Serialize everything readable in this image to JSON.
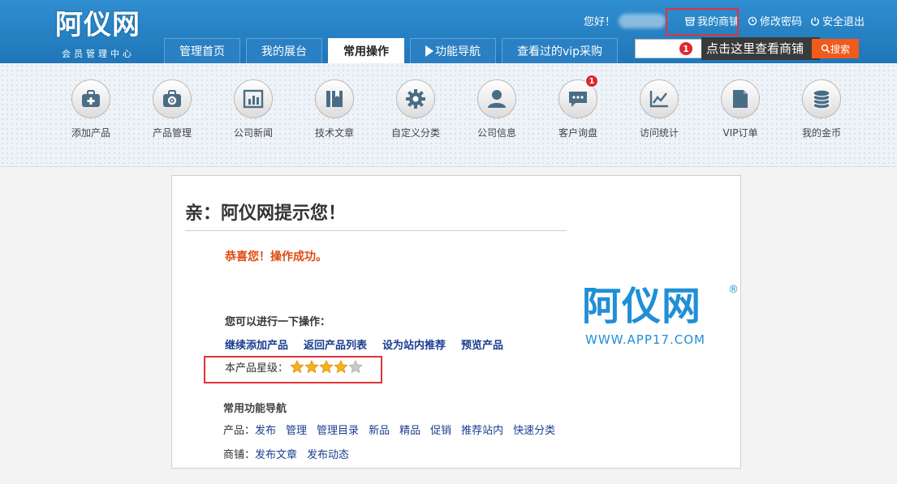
{
  "header": {
    "logo_text": "阿仪网",
    "logo_sub": "会员管理中心",
    "greeting": "您好！",
    "links": {
      "my_shop": "我的商铺",
      "change_password": "修改密码",
      "logout": "安全退出"
    },
    "search_placeholder": "",
    "search_button": "搜索",
    "badge": "1",
    "tooltip": "点击这里查看商铺"
  },
  "nav": {
    "tabs": [
      "管理首页",
      "我的展台",
      "常用操作",
      "功能导航",
      "查看过的vip采购"
    ],
    "active_index": 2
  },
  "toolbar": {
    "items": [
      {
        "label": "添加产品",
        "icon": "add-product-icon"
      },
      {
        "label": "产品管理",
        "icon": "product-manage-icon"
      },
      {
        "label": "公司新闻",
        "icon": "news-icon"
      },
      {
        "label": "技术文章",
        "icon": "article-icon"
      },
      {
        "label": "自定义分类",
        "icon": "gear-icon"
      },
      {
        "label": "公司信息",
        "icon": "user-icon"
      },
      {
        "label": "客户询盘",
        "icon": "chat-icon"
      },
      {
        "label": "访问统计",
        "icon": "stats-icon"
      },
      {
        "label": "VIP订单",
        "icon": "document-icon"
      },
      {
        "label": "我的金币",
        "icon": "coins-icon"
      }
    ],
    "inquiry_badge": "1"
  },
  "main": {
    "title": "亲：阿仪网提示您！",
    "success": "恭喜您！操作成功。",
    "ops_title": "您可以进行一下操作：",
    "ops_links": [
      "继续添加产品",
      "返回产品列表",
      "设为站内推荐",
      "预览产品"
    ],
    "rating_label": "本产品星级：",
    "rating": {
      "value": 4,
      "max": 5
    },
    "nav_title": "常用功能导航",
    "product_label": "产品：",
    "product_links": [
      "发布",
      "管理",
      "管理目录",
      "新品",
      "精品",
      "促销",
      "推荐站内",
      "快速分类"
    ],
    "shop_label": "商铺：",
    "shop_links": [
      "发布文章",
      "发布动态"
    ],
    "watermark": {
      "brand": "阿仪网",
      "reg": "®",
      "url": "WWW.APP17.COM"
    }
  },
  "colors": {
    "header_blue": "#1f76b8",
    "accent_orange": "#f25a1c",
    "link_blue": "#1a3d8f",
    "success_orange": "#e04a0e",
    "highlight_red": "#e0333a"
  }
}
